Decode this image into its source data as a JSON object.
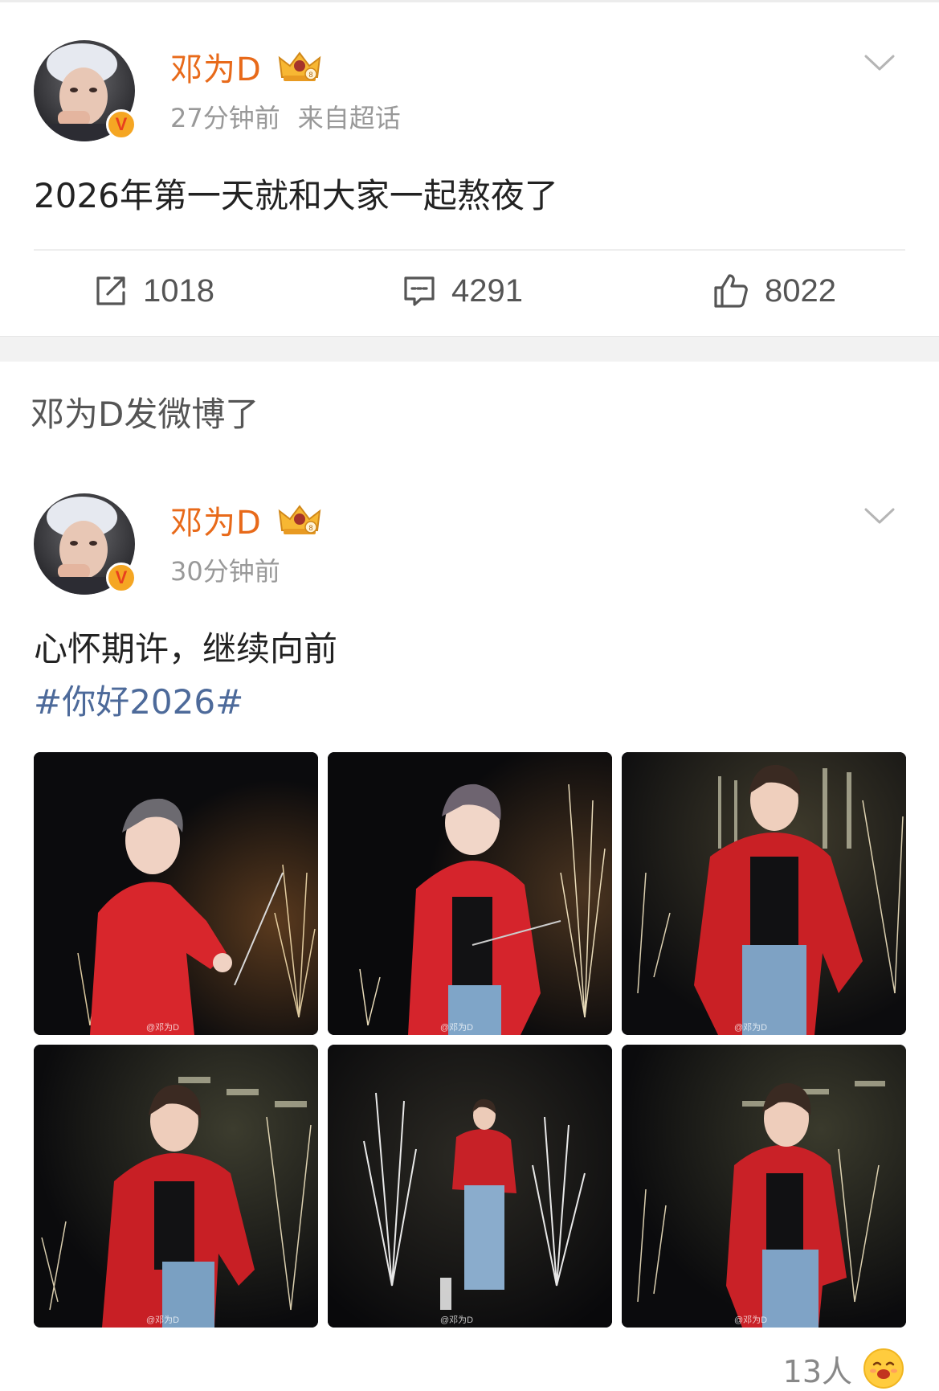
{
  "colors": {
    "username": "#e86a1a",
    "meta": "#999999",
    "hashtag": "#4d6a9a",
    "badge": "#f5a623",
    "separator_band": "#f2f2f2"
  },
  "post1": {
    "username": "邓为D",
    "time": "27分钟前",
    "source": "来自超话",
    "text": "2026年第一天就和大家一起熬夜了",
    "actions": {
      "repost_icon": "repost-icon",
      "repost_count": "1018",
      "comment_icon": "comment-icon",
      "comment_count": "4291",
      "like_icon": "thumbs-up-icon",
      "like_count": "8022"
    }
  },
  "section_header": "邓为D发微博了",
  "post2": {
    "username": "邓为D",
    "time": "30分钟前",
    "text": "心怀期许，继续向前",
    "hashtag": "#你好2026#",
    "photos": [
      {
        "watermark": "@邓为D"
      },
      {
        "watermark": "@邓为D"
      },
      {
        "watermark": "@邓为D"
      },
      {
        "watermark": "@邓为D"
      },
      {
        "watermark": "@邓为D"
      },
      {
        "watermark": "@邓为D"
      }
    ],
    "likes_text": "13人"
  }
}
